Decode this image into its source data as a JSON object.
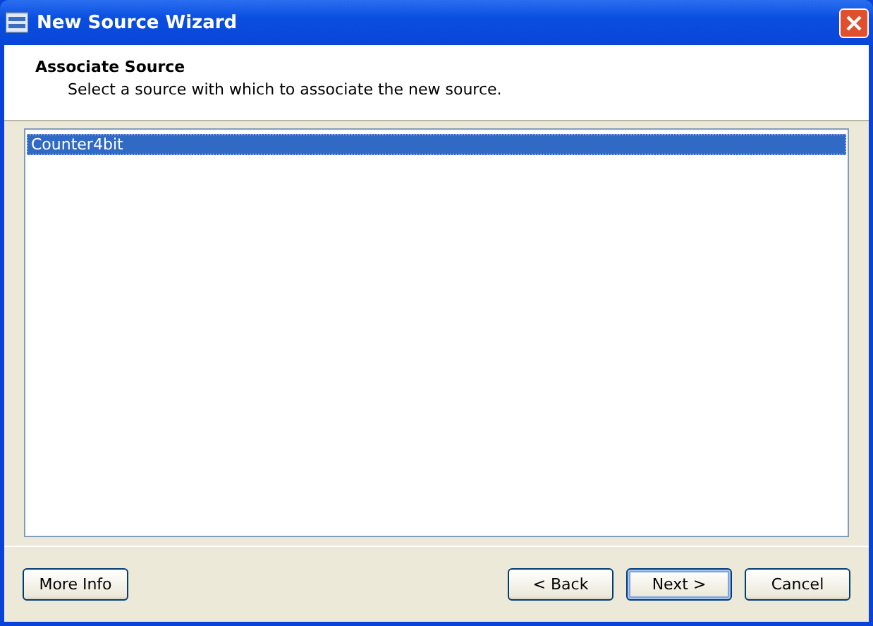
{
  "window": {
    "title": "New Source Wizard"
  },
  "header": {
    "title": "Associate Source",
    "subtitle": "Select a source with which to associate the new source."
  },
  "sources": [
    {
      "label": "Counter4bit",
      "selected": true
    }
  ],
  "buttons_left": [
    {
      "label": "More Info",
      "default": false
    }
  ],
  "buttons_right": [
    {
      "label": "< Back",
      "default": false
    },
    {
      "label": "Next >",
      "default": true
    },
    {
      "label": "Cancel",
      "default": false
    }
  ]
}
